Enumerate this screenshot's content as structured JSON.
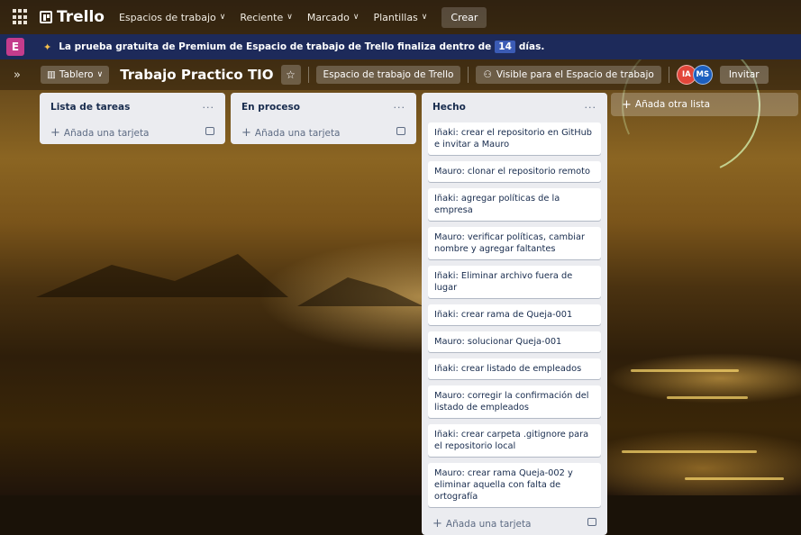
{
  "nav": {
    "logo": "Trello",
    "workspaces": "Espacios de trabajo",
    "recent": "Reciente",
    "starred": "Marcado",
    "templates": "Plantillas",
    "create": "Crear"
  },
  "banner": {
    "workspace_initial": "E",
    "text": "La prueba gratuita de Premium de Espacio de trabajo de Trello finaliza dentro de",
    "days_count": "14",
    "days_suffix": "días."
  },
  "board": {
    "view": "Tablero",
    "title": "Trabajo Practico TIO",
    "workspace_button": "Espacio de trabajo de Trello",
    "visibility": "Visible para el Espacio de trabajo",
    "members": [
      "IA",
      "MS"
    ],
    "invite": "Invitar"
  },
  "lists": [
    {
      "title": "Lista de tareas",
      "cards": [],
      "add_card": "Añada una tarjeta"
    },
    {
      "title": "En proceso",
      "cards": [],
      "add_card": "Añada una tarjeta"
    },
    {
      "title": "Hecho",
      "cards": [
        "Iñaki: crear el repositorio en GitHub e invitar a Mauro",
        "Mauro: clonar el repositorio remoto",
        "Iñaki: agregar políticas de la empresa",
        "Mauro: verificar políticas, cambiar nombre y agregar faltantes",
        "Iñaki: Eliminar archivo fuera de lugar",
        "Iñaki: crear rama de Queja-001",
        "Mauro: solucionar Queja-001",
        "Iñaki: crear listado de empleados",
        "Mauro: corregir la confirmación del listado de empleados",
        "Iñaki: crear carpeta .gitignore para el repositorio local",
        "Mauro: crear rama Queja-002 y eliminar aquella con falta de ortografía"
      ],
      "add_card": "Añada una tarjeta"
    }
  ],
  "add_list": "Añada otra lista",
  "colors": {
    "banner_bg": "#1d2a5a",
    "list_bg": "#ebecf0",
    "workspace_badge": "#c43c8c",
    "avatar_ia": "#e2463a",
    "avatar_ms": "#1d5fbf"
  }
}
